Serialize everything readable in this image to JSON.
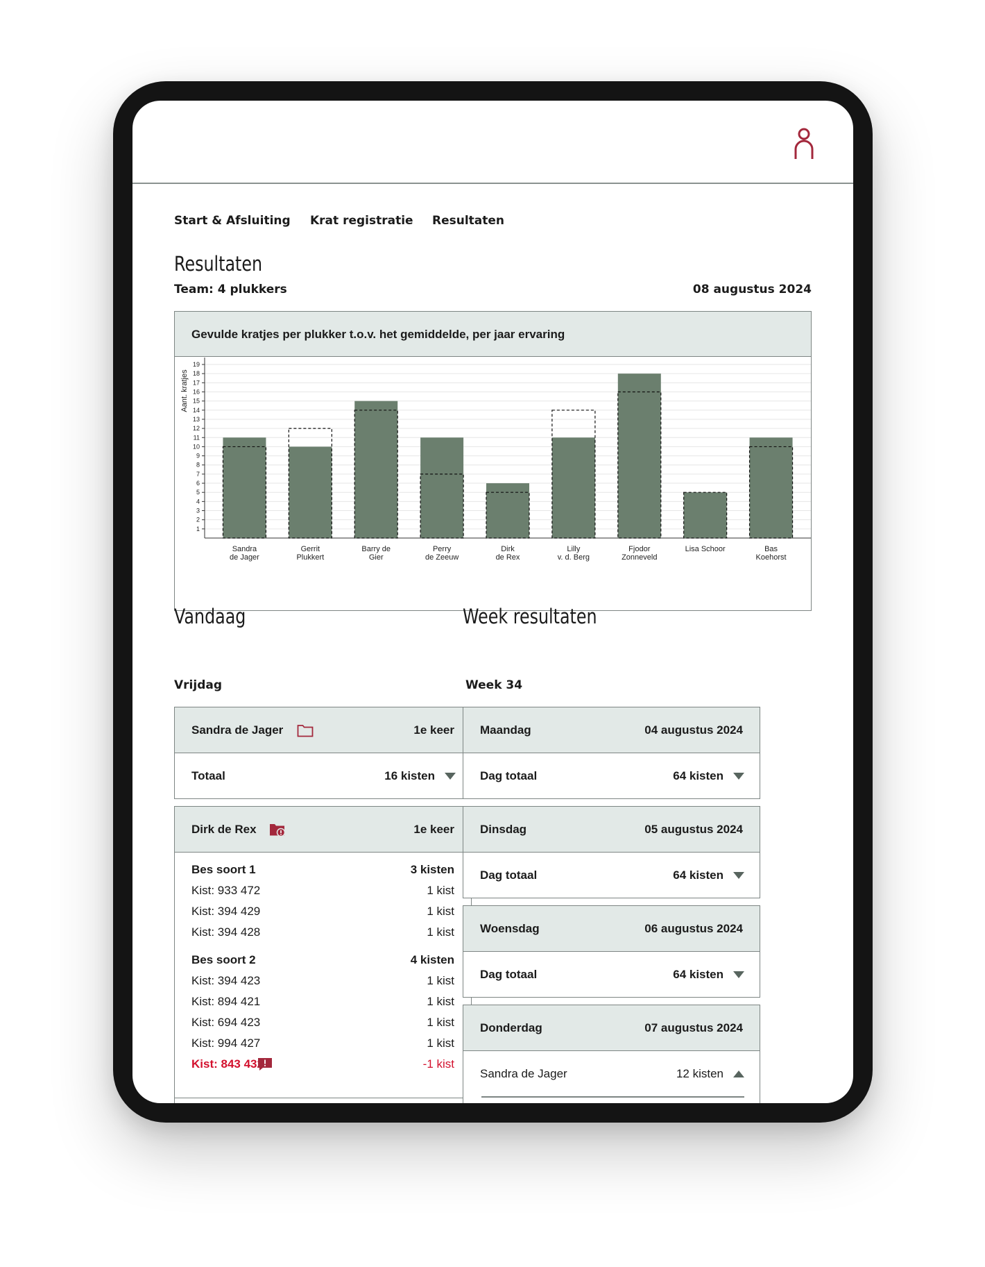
{
  "nav": [
    {
      "label": "Start & Afsluiting"
    },
    {
      "label": "Krat registratie"
    },
    {
      "label": "Resultaten"
    }
  ],
  "page": {
    "title": "Resultaten",
    "team": "Team: 4 plukkers",
    "date": "08 augustus 2024"
  },
  "colors": {
    "accent": "#a3283c",
    "bar": "#6b7f6e",
    "panel": "#e2e9e7",
    "warning": "#d3102d"
  },
  "chart_data": {
    "type": "bar",
    "title": "Gevulde kratjes per plukker t.o.v. het gemiddelde, per jaar ervaring",
    "ylabel": "Aant. kratjes",
    "xlabel": "",
    "ylim": [
      0,
      19
    ],
    "yticks": [
      1,
      2,
      3,
      4,
      5,
      6,
      7,
      8,
      9,
      10,
      11,
      12,
      13,
      14,
      15,
      16,
      17,
      18,
      19
    ],
    "categories": [
      [
        "Sandra",
        "de Jager"
      ],
      [
        "Gerrit",
        "Plukkert"
      ],
      [
        "Barry de",
        "Gier"
      ],
      [
        "Perry",
        "de Zeeuw"
      ],
      [
        "Dirk",
        "de Rex"
      ],
      [
        "Lilly",
        "v. d. Berg"
      ],
      [
        "Fjodor",
        "Zonneveld"
      ],
      [
        "Lisa Schoor"
      ],
      [
        "Bas",
        "Koehorst"
      ]
    ],
    "series": [
      {
        "values": [
          11,
          10,
          15,
          11,
          6,
          11,
          18,
          5,
          11
        ]
      },
      {
        "style": "dashed-outline",
        "values": [
          10,
          12,
          14,
          7,
          5,
          14,
          16,
          5,
          10
        ]
      }
    ],
    "grid": true
  },
  "vandaag": {
    "title": "Vandaag",
    "day": "Vrijdag",
    "card1": {
      "name": "Sandra de Jager",
      "icon": "folder-icon",
      "count": "1e keer",
      "total_label": "Totaal",
      "total_value": "16 kisten"
    },
    "card2": {
      "name": "Dirk de Rex",
      "icon": "folder-alert-icon",
      "count": "1e keer",
      "groups": [
        {
          "label": "Bes soort 1",
          "value": "3 kisten",
          "items": [
            {
              "label": "Kist: 933 472",
              "value": "1 kist"
            },
            {
              "label": "Kist: 394 429",
              "value": "1 kist"
            },
            {
              "label": "Kist: 394 428",
              "value": "1 kist"
            }
          ]
        },
        {
          "label": "Bes soort 2",
          "value": "4 kisten",
          "items": [
            {
              "label": "Kist: 394 423",
              "value": "1 kist"
            },
            {
              "label": "Kist: 894 421",
              "value": "1 kist"
            },
            {
              "label": "Kist: 694 423",
              "value": "1 kist"
            },
            {
              "label": "Kist: 994 427",
              "value": "1 kist"
            }
          ]
        }
      ],
      "warning": {
        "label": "Kist: 843 432",
        "value": "-1 kist",
        "icon": "message-alert-icon"
      }
    }
  },
  "week": {
    "title": "Week resultaten",
    "subtitle": "Week 34",
    "days": [
      {
        "day": "Maandag",
        "date": "04 augustus 2024",
        "row_label": "Dag totaal",
        "row_value": "64 kisten"
      },
      {
        "day": "Dinsdag",
        "date": "05 augustus 2024",
        "row_label": "Dag totaal",
        "row_value": "64 kisten"
      },
      {
        "day": "Woensdag",
        "date": "06 augustus 2024",
        "row_label": "Dag totaal",
        "row_value": "64 kisten"
      },
      {
        "day": "Donderdag",
        "date": "07 augustus 2024",
        "row_label": "Sandra de Jager",
        "row_value": "12 kisten"
      }
    ]
  }
}
